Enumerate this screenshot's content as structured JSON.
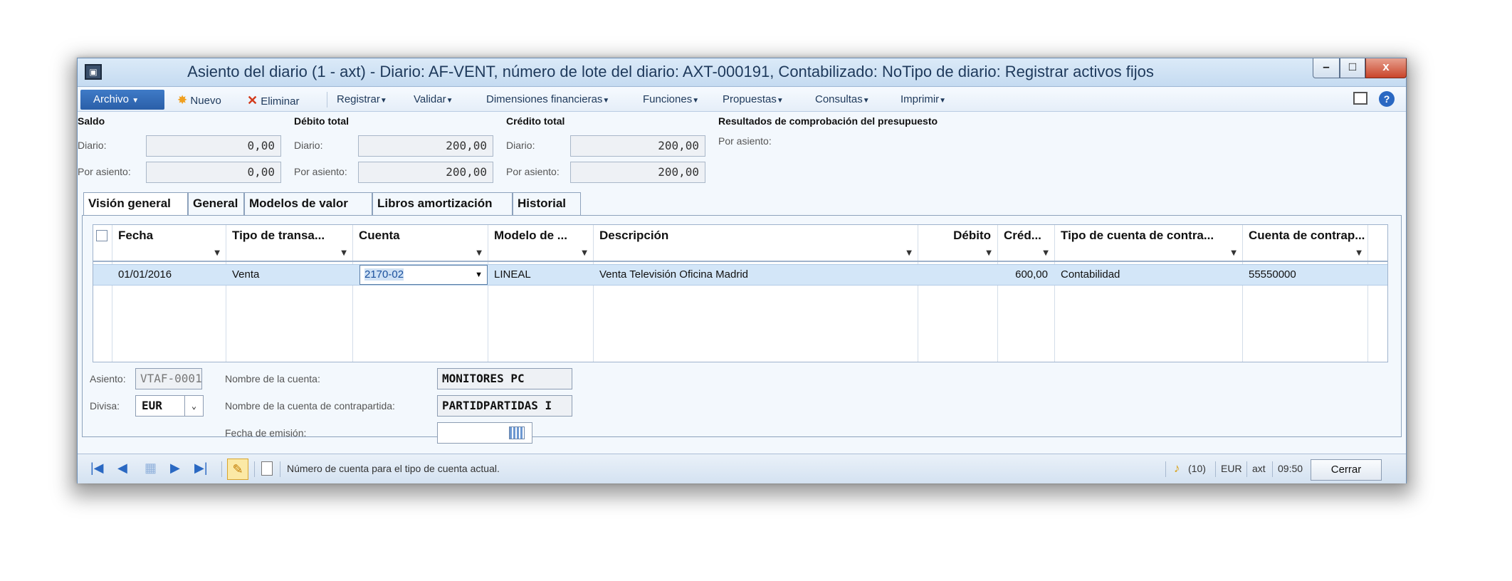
{
  "window": {
    "title": "Asiento del diario (1 - axt) - Diario: AF-VENT, número de lote del diario: AXT-000191, Contabilizado: NoTipo de diario: Registrar activos fijos",
    "min": "–",
    "max": "□",
    "close": "x"
  },
  "menu": {
    "archivo": "Archivo",
    "nuevo": "Nuevo",
    "eliminar": "Eliminar",
    "registrar": "Registrar",
    "validar": "Validar",
    "dimensiones": "Dimensiones financieras",
    "funciones": "Funciones",
    "propuestas": "Propuestas",
    "consultas": "Consultas",
    "imprimir": "Imprimir"
  },
  "summary": {
    "saldo": {
      "header": "Saldo",
      "diario_label": "Diario:",
      "diario_value": "0,00",
      "asiento_label": "Por asiento:",
      "asiento_value": "0,00"
    },
    "debito": {
      "header": "Débito total",
      "diario_label": "Diario:",
      "diario_value": "200,00",
      "asiento_label": "Por asiento:",
      "asiento_value": "200,00"
    },
    "credito": {
      "header": "Crédito total",
      "diario_label": "Diario:",
      "diario_value": "200,00",
      "asiento_label": "Por asiento:",
      "asiento_value": "200,00"
    },
    "presupuesto": {
      "header": "Resultados de comprobación del presupuesto",
      "label": "Por asiento:"
    }
  },
  "tabs": [
    "Visión general",
    "General",
    "Modelos de valor",
    "Libros amortización",
    "Historial"
  ],
  "grid": {
    "columns": [
      "Fecha",
      "Tipo de transa...",
      "Cuenta",
      "Modelo de ...",
      "Descripción",
      "Débito",
      "Créd...",
      "Tipo de cuenta de contra...",
      "Cuenta de contrap..."
    ],
    "rows": [
      {
        "fecha": "01/01/2016",
        "tipo": "Venta",
        "cuenta": "2170-02",
        "modelo": "LINEAL",
        "descripcion": "Venta Televisión Oficina Madrid",
        "debito": "",
        "credito": "600,00",
        "tipo_contra": "Contabilidad",
        "cuenta_contra": "55550000"
      }
    ]
  },
  "details": {
    "asiento_label": "Asiento:",
    "asiento_value": "VTAF-0001",
    "divisa_label": "Divisa:",
    "divisa_value": "EUR",
    "nombre_cuenta_label": "Nombre de la cuenta:",
    "nombre_cuenta_value": "MONITORES PC",
    "nombre_contra_label": "Nombre de la cuenta de contrapartida:",
    "nombre_contra_value": "PARTIDPARTIDAS I",
    "fecha_emision_label": "Fecha de emisión:",
    "fecha_emision_value": ""
  },
  "status": {
    "message": "Número de cuenta para el tipo de cuenta actual.",
    "notifications": "(10)",
    "currency": "EUR",
    "company": "axt",
    "time": "09:50",
    "close": "Cerrar"
  }
}
